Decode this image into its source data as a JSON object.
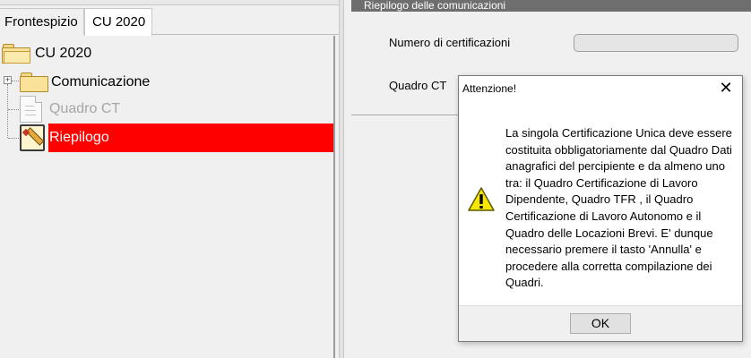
{
  "tabs": [
    {
      "label": "Frontespizio"
    },
    {
      "label": "CU 2020",
      "selected": true
    }
  ],
  "tree": {
    "root_label": "CU 2020",
    "items": [
      {
        "label": "Comunicazione",
        "icon": "folder-icon",
        "expandable": true
      },
      {
        "label": "Quadro CT",
        "icon": "document-icon",
        "disabled": true
      },
      {
        "label": "Riepilogo",
        "icon": "pencil-document-icon",
        "selected": true
      }
    ],
    "selected_color": "#ff0000"
  },
  "right_pane": {
    "group_title": "Riepilogo delle comunicazioni",
    "fields": {
      "numero_certificazioni_label": "Numero di certificazioni",
      "numero_certificazioni_value": "",
      "quadro_ct_label": "Quadro CT"
    }
  },
  "dialog": {
    "title": "Attenzione!",
    "close_glyph": "✕",
    "icon": "warning-icon",
    "message": "La singola Certificazione Unica deve essere costituita obbligatoriamente dal Quadro Dati anagrafici del percipiente e da almeno uno tra: il Quadro Certificazione di Lavoro Dipendente, Quadro TFR , il Quadro Certificazione di Lavoro Autonomo e il Quadro delle Locazioni Brevi. E' dunque necessario premere il tasto 'Annulla' e procedere alla corretta compilazione dei Quadri.",
    "ok_label": "OK"
  }
}
